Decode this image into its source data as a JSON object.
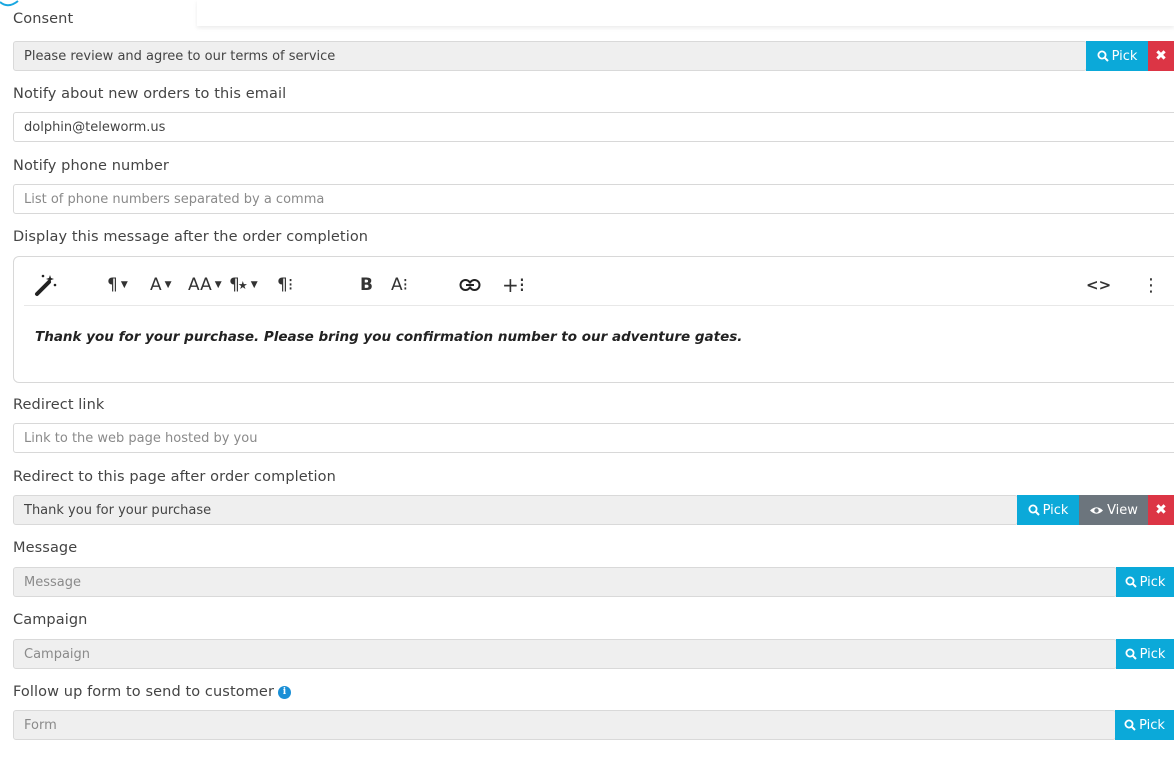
{
  "consent": {
    "label": "Consent",
    "value": "Please review and agree to our terms of service",
    "pick_label": "Pick",
    "clear_label": "✖"
  },
  "notify_email": {
    "label": "Notify about new orders to this email",
    "value": "dolphin@teleworm.us"
  },
  "notify_phone": {
    "label": "Notify phone number",
    "placeholder": "List of phone numbers separated by a comma"
  },
  "completion_message": {
    "label": "Display this message after the order completion",
    "content": "Thank you for your purchase. Please bring you confirmation number to our adventure gates.",
    "toolbar": {
      "paragraph": "¶",
      "font": "A",
      "font_size": "AA",
      "paragraph_style": "¶",
      "paragraph_more": "¶⁝",
      "bold": "B",
      "text_more": "A⁝",
      "insert_more": "+⁝",
      "code_view": "<>",
      "more": "⋮"
    }
  },
  "redirect_link": {
    "label": "Redirect link",
    "placeholder": "Link to the web page hosted by you"
  },
  "redirect_page": {
    "label": "Redirect to this page after order completion",
    "value": "Thank you for your purchase",
    "pick_label": "Pick",
    "view_label": "View",
    "clear_label": "✖"
  },
  "message": {
    "label": "Message",
    "placeholder": "Message",
    "pick_label": "Pick"
  },
  "campaign": {
    "label": "Campaign",
    "placeholder": "Campaign",
    "pick_label": "Pick"
  },
  "followup_form": {
    "label": "Follow up form to send to customer",
    "info": "i",
    "placeholder": "Form",
    "pick_label": "Pick"
  },
  "colors": {
    "pick": "#0ba9d9",
    "view": "#6c757d",
    "clear": "#dc3545",
    "info": "#1a8fd6"
  }
}
